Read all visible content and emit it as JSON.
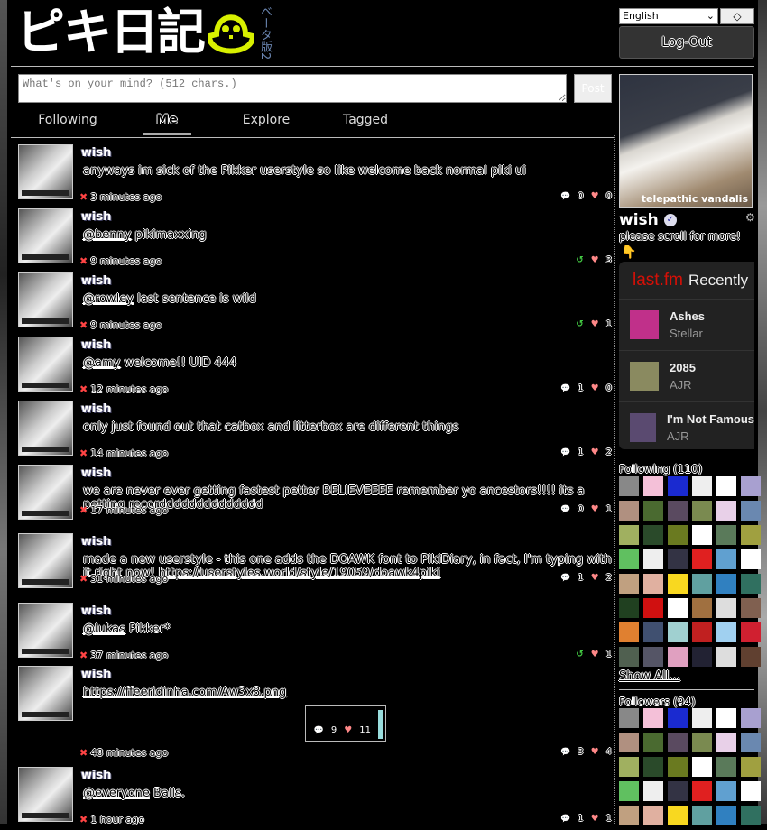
{
  "logo": {
    "text": "ピキ日記",
    "beta": "ベータ版2",
    "accent": "#d8f000"
  },
  "compose": {
    "placeholder": "What's on your mind? (512 chars.)",
    "post_label": "Post"
  },
  "tabs": [
    {
      "label": "Following"
    },
    {
      "label": "Me",
      "active": true
    },
    {
      "label": "Explore"
    },
    {
      "label": "Tagged"
    }
  ],
  "posts": [
    {
      "author": "wish",
      "segments": [
        {
          "t": "anyways im sick of the Pikker userstyle so like welcome back normal piki ui"
        }
      ],
      "time": "3 minutes ago",
      "comments": "0",
      "likes": "0"
    },
    {
      "author": "wish",
      "segments": [
        {
          "t": "@benny",
          "link": true
        },
        {
          "t": " pikimaxxing"
        }
      ],
      "time": "9 minutes ago",
      "reply": true,
      "likes": "3"
    },
    {
      "author": "wish",
      "segments": [
        {
          "t": "@rowley",
          "link": true
        },
        {
          "t": " last sentence is wild"
        }
      ],
      "time": "9 minutes ago",
      "reply": true,
      "likes": "1"
    },
    {
      "author": "wish",
      "segments": [
        {
          "t": "@amy",
          "link": true
        },
        {
          "t": " welcome!! UID 444"
        }
      ],
      "time": "12 minutes ago",
      "comments": "1",
      "likes": "0"
    },
    {
      "author": "wish",
      "segments": [
        {
          "t": "only just found out that catbox and litterbox are different things"
        }
      ],
      "time": "14 minutes ago",
      "comments": "1",
      "likes": "2"
    },
    {
      "author": "wish",
      "segments": [
        {
          "t": "we are never ever getting fastest petter BELIEVEEEE remember yo ancestors!!!! its a petting recordddddddddddddd"
        }
      ],
      "time": "17 minutes ago",
      "comments": "0",
      "likes": "1"
    },
    {
      "author": "wish",
      "segments": [
        {
          "t": "made a new userstyle - this one adds the DOAWK font to PikiDiary, in fact, I'm typing with it right now! "
        },
        {
          "t": "https://userstyles.world/style/19059/doawk4piki",
          "link": true
        }
      ],
      "time": "31 minutes ago",
      "comments": "1",
      "likes": "2"
    },
    {
      "author": "wish",
      "segments": [
        {
          "t": "@lukas",
          "link": true
        },
        {
          "t": " Pikker*"
        }
      ],
      "time": "37 minutes ago",
      "reply": true,
      "likes": "1"
    },
    {
      "author": "wish",
      "segments": [
        {
          "t": "https://ffeeridinha.com/Aw3x8.png",
          "link": true
        }
      ],
      "time": "48 minutes ago",
      "comments": "3",
      "likes": "4",
      "preview": {
        "comments": "9",
        "likes": "11"
      }
    },
    {
      "author": "wish",
      "segments": [
        {
          "t": "@everyone",
          "link": true
        },
        {
          "t": " Balls."
        }
      ],
      "time": "1 hour ago",
      "comments": "1",
      "likes": "1"
    }
  ],
  "sidebar": {
    "language": "English",
    "logout_label": "Log-Out",
    "profile": {
      "watermark": "telepathic vandalis",
      "username": "wish",
      "bio": "please scroll for more!"
    },
    "lastfm": {
      "logo": "last.fm",
      "title": "Recently",
      "tracks": [
        {
          "title": "Ashes",
          "artist": "Stellar",
          "color": "#c0308a"
        },
        {
          "title": "2085",
          "artist": "AJR",
          "color": "#8a8a60"
        },
        {
          "title": "I'm Not Famous",
          "artist": "AJR",
          "color": "#5a4a70"
        }
      ]
    },
    "following_label": "Following (110)",
    "show_all": "Show All...",
    "followers_label": "Followers (94)",
    "avatar_colors": [
      "#888",
      "#f4c0d8",
      "#1a2ad0",
      "#eee",
      "#fff",
      "#a8a0d0",
      "#b09080",
      "#4a6a30",
      "#5a4a60",
      "#7a8a50",
      "#e8d0e8",
      "#6a88b0",
      "#a0b060",
      "#2a4a2a",
      "#6a7a20",
      "#fff",
      "#5a7a5a",
      "#a0a040",
      "#60c060",
      "#eee",
      "#334",
      "#e02020",
      "#60a0d0",
      "#fff",
      "#c0a080",
      "#e0b0a0",
      "#f8d820",
      "#60a0a0",
      "#3080c0",
      "#307060",
      "#204020",
      "#d01010",
      "#fff",
      "#a07040",
      "#ddd",
      "#806050",
      "#e08030",
      "#405070",
      "#a0d0d0",
      "#c02020",
      "#a0d0f0",
      "#d02030",
      "#506050",
      "#556",
      "#e0a0c0",
      "#223",
      "#ddd",
      "#604030"
    ]
  }
}
